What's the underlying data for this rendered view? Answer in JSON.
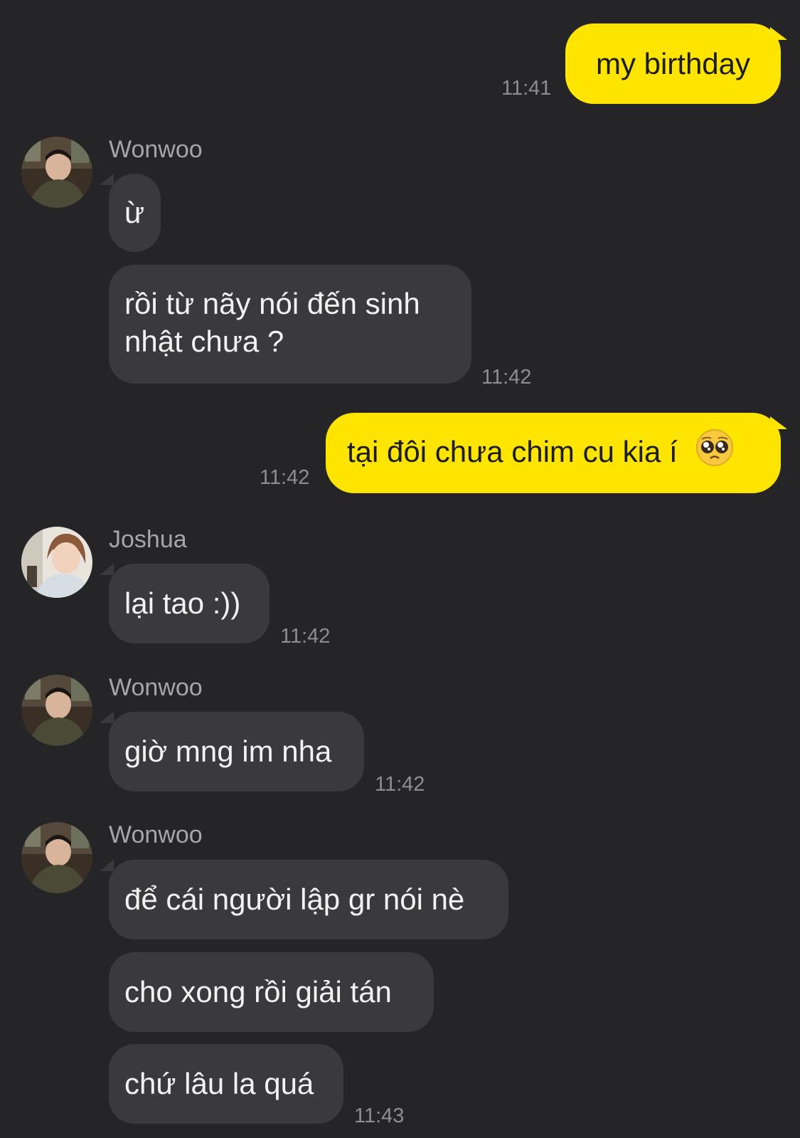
{
  "colors": {
    "background": "#252528",
    "outgoing_bubble": "#fde500",
    "incoming_bubble": "#3a3a3d",
    "timestamp": "#8d8d92"
  },
  "messages": {
    "m1": {
      "text": "my birthday",
      "time": "11:41"
    },
    "g1": {
      "sender": "Wonwoo",
      "lines": [
        "ừ",
        "rồi từ nãy nói đến sinh nhật chưa ?"
      ],
      "time": "11:42"
    },
    "m2": {
      "text": "tại đôi chưa chim cu kia í",
      "emoji": "pleading-face-emoji",
      "time": "11:42"
    },
    "g2": {
      "sender": "Joshua",
      "lines": [
        "lại tao :))"
      ],
      "time": "11:42"
    },
    "g3": {
      "sender": "Wonwoo",
      "lines": [
        "giờ mng im nha"
      ],
      "time": "11:42"
    },
    "g4": {
      "sender": "Wonwoo",
      "lines": [
        "để cái người lập gr nói nè",
        "cho xong rồi giải tán",
        "chứ lâu la quá"
      ],
      "time": "11:43"
    }
  }
}
